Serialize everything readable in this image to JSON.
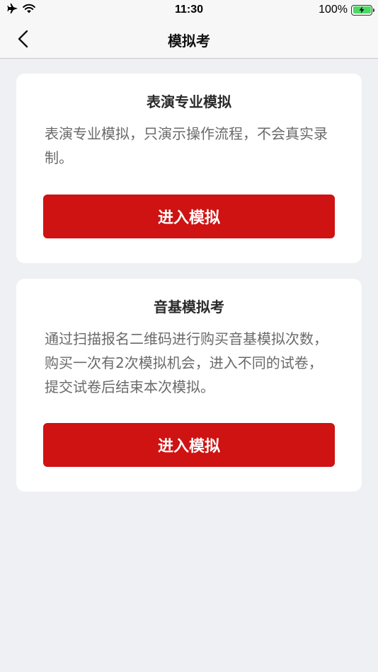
{
  "status_bar": {
    "time": "11:30",
    "battery_percent": "100%",
    "icons": [
      "airplane-icon",
      "wifi-icon",
      "battery-charging-icon"
    ]
  },
  "nav": {
    "title": "模拟考",
    "back_icon": "chevron-left-icon"
  },
  "cards": [
    {
      "title": "表演专业模拟",
      "description": "表演专业模拟，只演示操作流程，不会真实录制。",
      "button_label": "进入模拟"
    },
    {
      "title": "音基模拟考",
      "description": "通过扫描报名二维码进行购买音基模拟次数，购买一次有2次模拟机会，进入不同的试卷，提交试卷后结束本次模拟。",
      "button_label": "进入模拟"
    }
  ],
  "colors": {
    "accent": "#cf1212",
    "background": "#eef0f4",
    "card": "#ffffff",
    "battery": "#4cd964"
  }
}
